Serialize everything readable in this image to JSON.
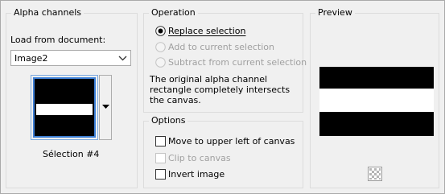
{
  "alpha_channels": {
    "title": "Alpha channels",
    "load_from_label": "Load from document:",
    "document_value": "Image2",
    "selection_name": "Sélection #4"
  },
  "operation": {
    "title": "Operation",
    "options": [
      {
        "label": "Replace selection",
        "selected": true,
        "enabled": true
      },
      {
        "label": "Add to current selection",
        "selected": false,
        "enabled": false
      },
      {
        "label": "Subtract from current selection",
        "selected": false,
        "enabled": false
      }
    ],
    "description": "The original alpha channel rectangle completely intersects the canvas."
  },
  "options_group": {
    "title": "Options",
    "items": [
      {
        "label": "Move to upper left of canvas",
        "checked": false,
        "enabled": true
      },
      {
        "label": "Clip to canvas",
        "checked": false,
        "enabled": false
      },
      {
        "label": "Invert image",
        "checked": false,
        "enabled": true
      }
    ]
  },
  "preview": {
    "title": "Preview"
  },
  "icons": {
    "document_dropdown": "chevron-down-icon",
    "channel_dropdown": "triangle-down-icon",
    "background_toggle": "checkerboard-icon"
  },
  "colors": {
    "selection_border": "#3d7fd6",
    "background": "#f0f0f0",
    "disabled_text": "#a0a0a0"
  }
}
